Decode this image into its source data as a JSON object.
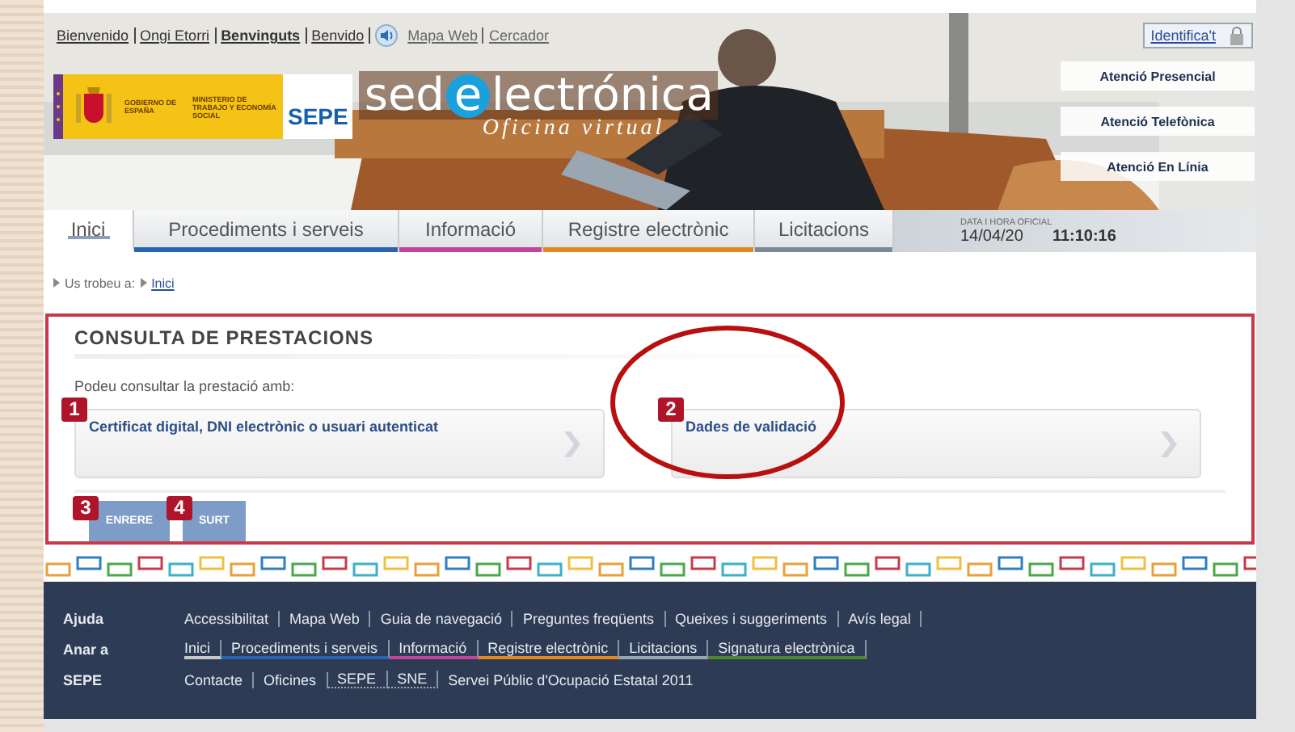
{
  "top_links": [
    {
      "label": "Bienvenido",
      "selected": false
    },
    {
      "label": "Ongi Etorri",
      "selected": false
    },
    {
      "label": "Benvinguts",
      "selected": true
    },
    {
      "label": "Benvido",
      "selected": false
    }
  ],
  "utility_links": [
    "Mapa Web",
    "Cercador"
  ],
  "logo": {
    "gov": "GOBIERNO DE ESPAÑA",
    "ministry": "MINISTERIO DE TRABAJO Y ECONOMÍA SOCIAL",
    "agency": "SEPE",
    "wordmark": {
      "before": "sed",
      "circled": "e",
      "after": "lectrónica"
    },
    "tagline": "Oficina virtual"
  },
  "login": "Identifica't",
  "attention_buttons": [
    "Atenció Presencial",
    "Atenció Telefònica",
    "Atenció En Línia"
  ],
  "tabs": [
    {
      "label": "Inici",
      "selected": true,
      "color": "#8aa0b8"
    },
    {
      "label": "Procediments i serveis",
      "selected": false,
      "color": "#2a64b0"
    },
    {
      "label": "Informació",
      "selected": false,
      "color": "#c2459b"
    },
    {
      "label": "Registre electrònic",
      "selected": false,
      "color": "#e08a1e"
    },
    {
      "label": "Licitacions",
      "selected": false,
      "color": "#7b8a99"
    }
  ],
  "clock": {
    "label": "DATA I HORA OFICIAL",
    "date": "14/04/20",
    "time": "11:10:16"
  },
  "breadcrumb": {
    "label": "Us trobeu a:",
    "links": [
      "Inici"
    ]
  },
  "panel": {
    "title": "CONSULTA DE PRESTACIONS",
    "intro": "Podeu consultar la prestació amb:",
    "options": [
      {
        "label": "Certificat digital, DNI electrònic o usuari autenticat",
        "badge": "1",
        "circled": false
      },
      {
        "label": "Dades de validació",
        "badge": "2",
        "circled": true
      }
    ],
    "buttons": [
      {
        "label": "ENRERE",
        "badge": "3"
      },
      {
        "label": "SURT",
        "badge": "4"
      }
    ]
  },
  "footer": [
    {
      "label": "Ajuda",
      "items": [
        {
          "kind": "link",
          "label": "Accessibilitat"
        },
        {
          "kind": "link",
          "label": "Mapa Web"
        },
        {
          "kind": "link",
          "label": "Guia de navegació"
        },
        {
          "kind": "link",
          "label": "Preguntes freqüents"
        },
        {
          "kind": "link",
          "label": "Queixes i suggeriments"
        },
        {
          "kind": "link",
          "label": "Avís legal"
        }
      ]
    },
    {
      "label": "Anar a",
      "items": [
        {
          "kind": "link",
          "label": "Inici",
          "color": "#c8c8c8"
        },
        {
          "kind": "link",
          "label": "Procediments i serveis",
          "color": "#2a64b0"
        },
        {
          "kind": "link",
          "label": "Informació",
          "color": "#c2459b"
        },
        {
          "kind": "link",
          "label": "Registre electrònic",
          "color": "#e08a1e"
        },
        {
          "kind": "link",
          "label": "Licitacions",
          "color": "#9aa4ae"
        },
        {
          "kind": "link",
          "label": "Signatura electrònica",
          "color": "#4a8a2a"
        }
      ]
    },
    {
      "label": "SEPE",
      "items": [
        {
          "kind": "link",
          "label": "Contacte"
        },
        {
          "kind": "link",
          "label": "Oficines"
        },
        {
          "kind": "abbr",
          "label": "SEPE"
        },
        {
          "kind": "abbr",
          "label": "SNE"
        },
        {
          "kind": "text",
          "label": "Servei Públic d'Ocupació Estatal 2011"
        }
      ]
    }
  ]
}
